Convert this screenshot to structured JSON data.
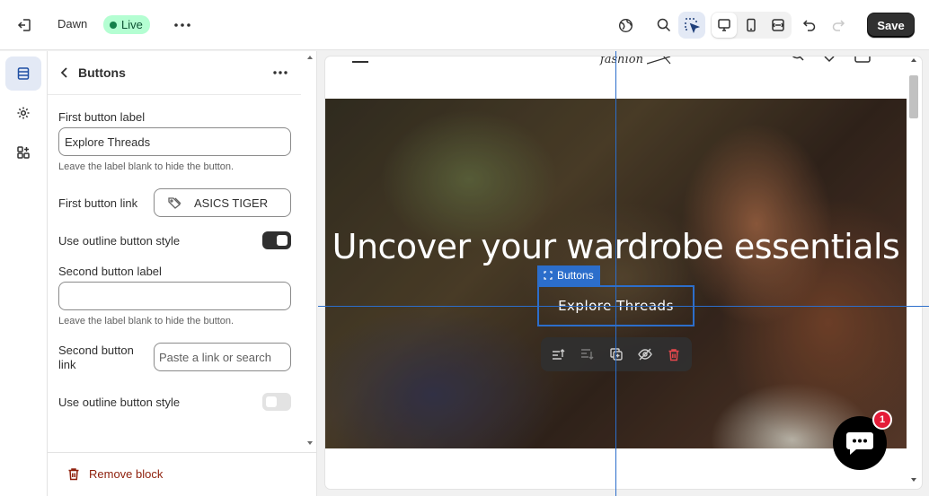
{
  "topbar": {
    "theme_name": "Dawn",
    "status_label": "Live",
    "save_label": "Save"
  },
  "panel": {
    "title": "Buttons",
    "first_button_label_title": "First button label",
    "first_button_label_value": "Explore Threads",
    "first_button_label_help": "Leave the label blank to hide the button.",
    "first_button_link_title": "First button link",
    "first_button_link_value": "ASICS TIGER",
    "outline_style_1_title": "Use outline button style",
    "outline_style_1_on": true,
    "second_button_label_title": "Second button label",
    "second_button_label_value": "",
    "second_button_label_help": "Leave the label blank to hide the button.",
    "second_button_link_title": "Second button link",
    "second_button_link_placeholder": "Paste a link or search",
    "outline_style_2_title": "Use outline button style",
    "outline_style_2_on": false,
    "remove_block_label": "Remove block"
  },
  "preview": {
    "logo_text": "fashion",
    "hero_heading": "Uncover your wardrobe essentials",
    "hero_button_label": "Explore Threads",
    "selection_label": "Buttons",
    "chat_badge_count": "1"
  },
  "colors": {
    "accent": "#2c6ecb",
    "live_badge_bg": "#b4fed2",
    "remove_red": "#8e1f0b",
    "badge_red": "#e51c38"
  }
}
